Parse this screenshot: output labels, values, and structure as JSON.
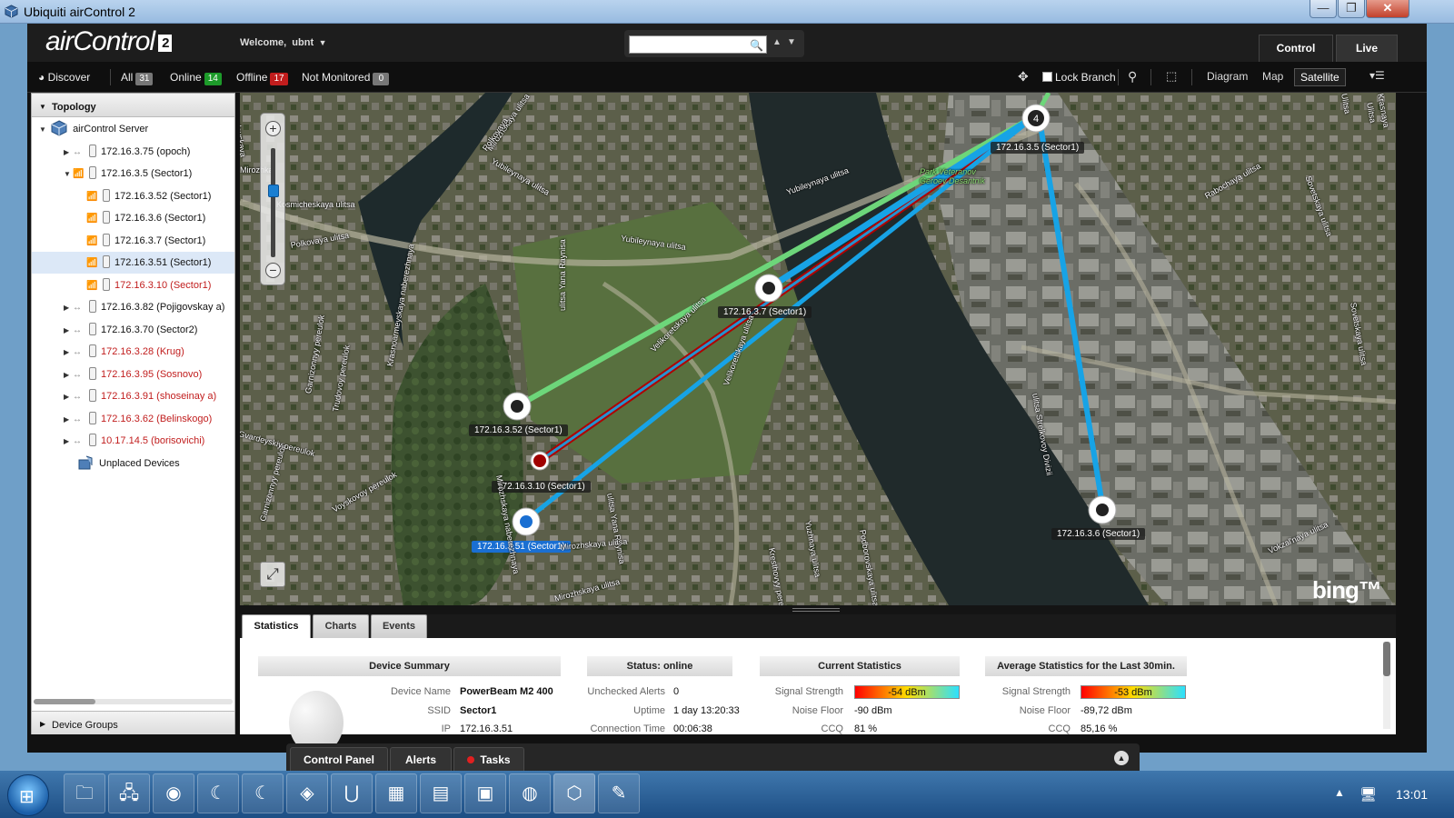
{
  "window": {
    "title": "Ubiquiti airControl 2",
    "minimize": "—",
    "maximize": "❐",
    "close": "✕"
  },
  "header": {
    "logo_text": "airControl",
    "logo_version": "2",
    "welcome_label": "Welcome,",
    "user": "ubnt",
    "search_value": "",
    "search_placeholder": "",
    "mode_tabs": [
      {
        "label": "Control",
        "active": true
      },
      {
        "label": "Live",
        "active": false
      }
    ]
  },
  "toolbar": {
    "discover": "Discover",
    "filters": [
      {
        "label": "All",
        "count": "31",
        "color": "gray"
      },
      {
        "label": "Online",
        "count": "14",
        "color": "green"
      },
      {
        "label": "Offline",
        "count": "17",
        "color": "red"
      },
      {
        "label": "Not Monitored",
        "count": "0",
        "color": "gray"
      }
    ],
    "lock_branch": "Lock Branch",
    "lock_branch_checked": false,
    "views": [
      {
        "label": "Diagram"
      },
      {
        "label": "Map"
      },
      {
        "label": "Satellite",
        "active": true
      }
    ]
  },
  "sidebar": {
    "title": "Topology",
    "server": "airControl Server",
    "tree": [
      {
        "label": "172.16.3.75 (opoch)",
        "level": 1,
        "offline": false,
        "expand": "▶"
      },
      {
        "label": "172.16.3.5 (Sector1)",
        "level": 1,
        "offline": false,
        "expand": "▼"
      },
      {
        "label": "172.16.3.52 (Sector1)",
        "level": 2,
        "offline": false
      },
      {
        "label": "172.16.3.6 (Sector1)",
        "level": 2,
        "offline": false
      },
      {
        "label": "172.16.3.7 (Sector1)",
        "level": 2,
        "offline": false
      },
      {
        "label": "172.16.3.51 (Sector1)",
        "level": 2,
        "offline": false,
        "selected": true
      },
      {
        "label": "172.16.3.10 (Sector1)",
        "level": 2,
        "offline": true
      },
      {
        "label": "172.16.3.82 (Pojigovskay a)",
        "level": 1,
        "offline": false,
        "expand": "▶"
      },
      {
        "label": "172.16.3.70 (Sector2)",
        "level": 1,
        "offline": false,
        "expand": "▶"
      },
      {
        "label": "172.16.3.28 (Krug)",
        "level": 1,
        "offline": true,
        "expand": "▶"
      },
      {
        "label": "172.16.3.95 (Sosnovo)",
        "level": 1,
        "offline": true,
        "expand": "▶"
      },
      {
        "label": "172.16.3.91 (shoseinay a)",
        "level": 1,
        "offline": true,
        "expand": "▶"
      },
      {
        "label": "172.16.3.62 (Belinskogo)",
        "level": 1,
        "offline": true,
        "expand": "▶"
      },
      {
        "label": "10.17.14.5 (borisovichi)",
        "level": 1,
        "offline": true,
        "expand": "▶"
      }
    ],
    "unplaced": "Unplaced Devices",
    "device_groups": "Device Groups"
  },
  "map": {
    "device_labels": [
      {
        "text": "172.16.3.5 (Sector1)"
      },
      {
        "text": "172.16.3.7 (Sector1)"
      },
      {
        "text": "172.16.3.52 (Sector1)"
      },
      {
        "text": "172.16.3.10 (Sector1)"
      },
      {
        "text": "172.16.3.51 (Sector1)",
        "active": true
      },
      {
        "text": "172.16.3.6 (Sector1)"
      }
    ],
    "ap_client_count": "4",
    "streets": [
      "Kosmicheskaya ulitsa",
      "Polkovaya ulitsa",
      "Yubileynaya ulitsa",
      "Yubileynaya ulitsa",
      "Yubileynaya ulitsa",
      "Velikoretskaya ulitsa",
      "Velikoretskaya ulitsa",
      "ulitsa Yana Raynisa",
      "ulitsa Yana Raynisa",
      "Mirozhskaya ulitsa",
      "Mirozhskaya ulitsa",
      "Mirozhskaya ulitsa",
      "Krasnoarmeyskaya naberezhnaya",
      "Trudovoy pereulok",
      "Garnizonnyy pereulok",
      "Voyskovoy pereulok",
      "Garnizonnyy pereulok",
      "Gvardeyskiy pereulok",
      "Mirozhskaya naberezhnaya",
      "Yuzhnaya ulitsa",
      "Podborovskaya ulitsa",
      "Kresthovyy pereulok",
      "ulitsa Strelkovoy Divizii",
      "Rabochaya ulitsa",
      "Sovetskaya ulitsa",
      "Vokzal'naya ulitsa",
      "Sovetskaya ulitsa",
      "Krasnaya",
      "Zaplavskaya",
      "Polkovaya",
      "Mirozhka",
      "Ulitsa",
      "Ulitsa"
    ],
    "park_label": "Park Veteranov Geroev Desantnik",
    "bing": "bing™",
    "zoom_in": "+",
    "zoom_out": "−",
    "zoom_level": 0.6,
    "link_colors": {
      "green": "#6dd67a",
      "blue": "#17a3e6",
      "red": "#b00000"
    }
  },
  "bottom": {
    "tabs": [
      {
        "label": "Statistics",
        "active": true
      },
      {
        "label": "Charts"
      },
      {
        "label": "Events"
      }
    ],
    "device_summary": {
      "title": "Device Summary",
      "rows": [
        {
          "k": "Device Name",
          "v": "PowerBeam M2 400"
        },
        {
          "k": "SSID",
          "v": "Sector1"
        },
        {
          "k": "IP",
          "v": "172.16.3.51"
        }
      ]
    },
    "status": {
      "title": "Status: online",
      "rows": [
        {
          "k": "Unchecked Alerts",
          "v": "0"
        },
        {
          "k": "Uptime",
          "v": "1 day 13:20:33"
        },
        {
          "k": "Connection Time",
          "v": "00:06:38"
        }
      ]
    },
    "current": {
      "title": "Current Statistics",
      "signal_label": "Signal Strength",
      "signal": "-54 dBm",
      "noise_label": "Noise Floor",
      "noise": "-90 dBm",
      "ccq_label": "CCQ",
      "ccq": "81 %"
    },
    "average": {
      "title": "Average Statistics for the Last 30min.",
      "signal_label": "Signal Strength",
      "signal": "-53 dBm",
      "noise_label": "Noise Floor",
      "noise": "-89,72 dBm",
      "ccq_label": "CCQ",
      "ccq": "85,16 %"
    }
  },
  "panel": {
    "control_panel": "Control Panel",
    "alerts": "Alerts",
    "tasks": "Tasks"
  },
  "taskbar": {
    "clock": "13:01"
  }
}
